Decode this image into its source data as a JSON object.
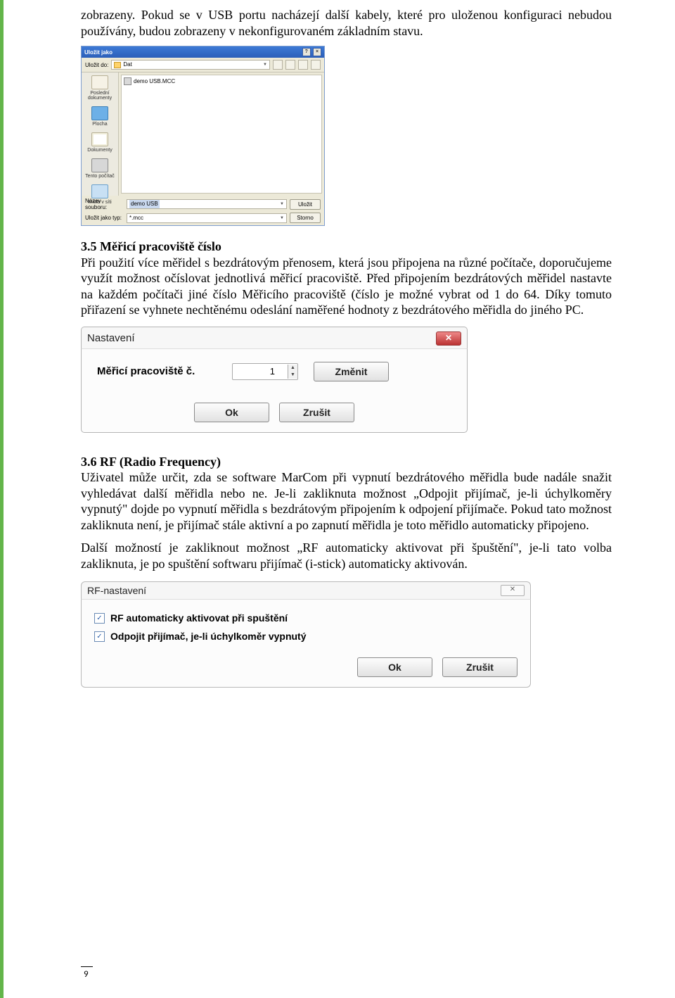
{
  "para1": "zobrazeny. Pokud se v USB portu nacházejí další kabely, které pro uloženou konfiguraci nebudou používány, budou zobrazeny v nekonfigurovaném základním stavu.",
  "saveas": {
    "title": "Uložit jako",
    "lookin_label": "Uložit do:",
    "lookin_value": "Dat",
    "file_item": "demo USB.MCC",
    "places": [
      "Poslední dokumenty",
      "Plocha",
      "Dokumenty",
      "Tento počítač",
      "Místa v síti"
    ],
    "name_label": "Název souboru:",
    "name_value": "demo USB",
    "type_label": "Uložit jako typ:",
    "type_value": "*.mcc",
    "save_btn": "Uložit",
    "cancel_btn": "Storno"
  },
  "sec35": {
    "head": "3.5 Měřicí pracoviště číslo",
    "body": "Při použití více měřidel s bezdrátovým přenosem, která jsou připojena na různé počítače, doporučujeme využít možnost očíslovat jednotlivá měřicí pracoviště. Před připojením bezdrátových měřidel nastavte na každém počítači jiné číslo Měřicího pracoviště (číslo je možné vybrat od 1 do 64. Díky tomuto přiřazení se vyhnete nechtěnému odeslání naměřené hodnoty z bezdrátového měřidla do jiného PC."
  },
  "nastav": {
    "title": "Nastavení",
    "label": "Měřicí pracoviště č.",
    "value": "1",
    "change": "Změnit",
    "ok": "Ok",
    "cancel": "Zrušit"
  },
  "sec36": {
    "head": "3.6 RF (Radio Frequency)",
    "body": "Uživatel může určit, zda se software MarCom při vypnutí bezdrátového měřidla bude nadále snažit vyhledávat další měřidla nebo ne. Je-li zakliknuta možnost „Odpojit přijímač, je-li úchylkoměry vypnutý\" dojde po vypnutí měřidla s bezdrátovým připojením k odpojení přijímače. Pokud tato možnost zakliknuta není, je přijímač stále aktivní a po zapnutí měřidla je toto měřidlo automaticky připojeno.",
    "body2": "Další možností je zakliknout možnost „RF automaticky aktivovat při špuštění\", je-li tato volba zakliknuta, je po spuštění softwaru přijímač (i-stick) automaticky aktivován."
  },
  "rf": {
    "title": "RF-nastavení",
    "opt1": "RF automaticky aktivovat při spuštění",
    "opt2": "Odpojit přijímač, je-li úchylkoměr vypnutý",
    "ok": "Ok",
    "cancel": "Zrušit"
  },
  "page_number": "9"
}
